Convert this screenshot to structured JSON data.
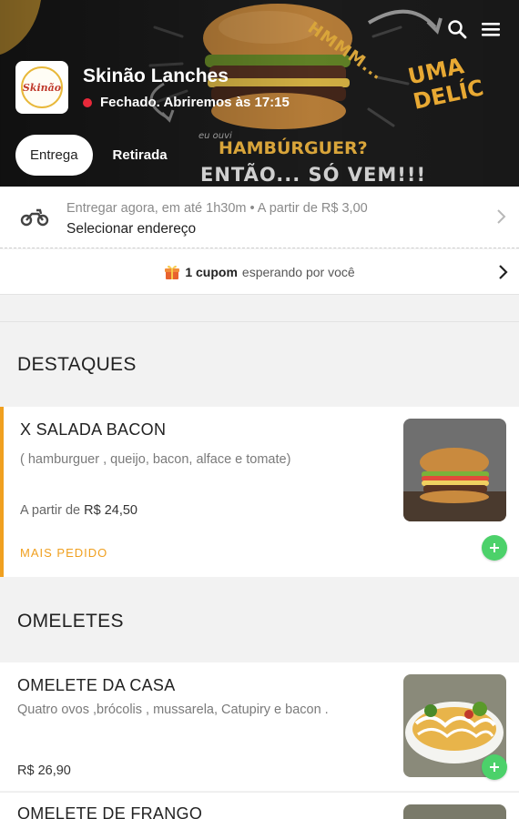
{
  "store": {
    "name": "Skinão Lanches",
    "logo_text": "Skinão",
    "status": "Fechado. Abriremos às 17:15",
    "status_color": "#e8293a"
  },
  "hero": {
    "hmmm": "HMMM...",
    "uma": "UMA DELÍC",
    "eu_ouvi": "eu ouvi",
    "hamburguer": "HAMBÚRGUER?",
    "entao": "ENTÃO... SÓ VEM!!!"
  },
  "header_icons": [
    "search-icon",
    "menu-icon"
  ],
  "tabs": [
    {
      "label": "Entrega",
      "active": true
    },
    {
      "label": "Retirada",
      "active": false
    }
  ],
  "delivery": {
    "info": "Entregar agora, em até 1h30m  •  A partir de R$ 3,00",
    "address_label": "Selecionar endereço"
  },
  "coupon": {
    "count": "1 cupom",
    "text": "esperando por você"
  },
  "sections": [
    {
      "title": "DESTAQUES",
      "items": [
        {
          "name": "X SALADA BACON",
          "description": "( hamburguer , queijo, bacon, alface e tomate)",
          "price_prefix": "A partir de",
          "price": "R$ 24,50",
          "badge": "MAIS PEDIDO"
        }
      ]
    },
    {
      "title": "OMELETES",
      "items": [
        {
          "name": "OMELETE DA CASA",
          "description": "Quatro ovos ,brócolis , mussarela, Catupiry e bacon .",
          "price": "R$ 26,90"
        },
        {
          "name": "OMELETE DE FRANGO"
        }
      ]
    }
  ],
  "colors": {
    "accent_orange": "#f0a020",
    "add_green": "#4cd16a",
    "hero_gold": "#d9a53a"
  }
}
